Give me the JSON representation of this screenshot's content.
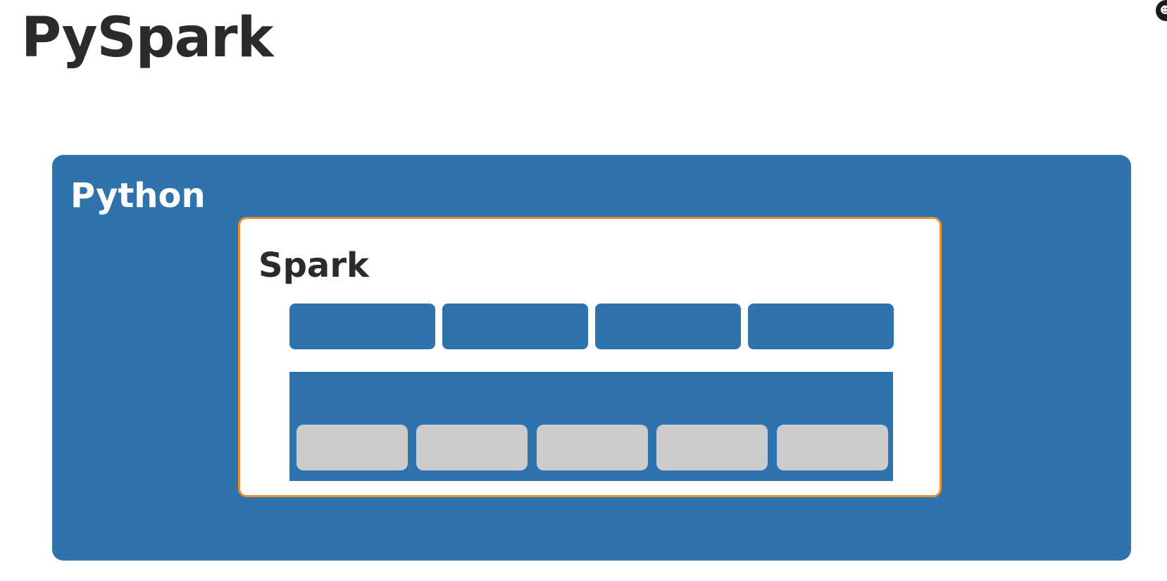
{
  "slide": {
    "title": "PySpark"
  },
  "diagram": {
    "outer_box": {
      "label": "Python",
      "color": "#2f73ae"
    },
    "inner_box": {
      "label": "Spark",
      "border_color": "#e8922f"
    },
    "top_blocks_count": 4,
    "bottom_blocks_count": 5,
    "bottom_block_color": "#cccccc"
  }
}
